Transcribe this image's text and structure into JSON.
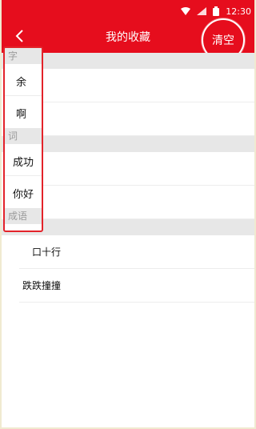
{
  "status_bar": {
    "time": "12:30",
    "icons": [
      "wifi-icon",
      "signal-icon",
      "battery-icon"
    ]
  },
  "header": {
    "title": "我的收藏",
    "back_icon": "chevron-left-icon",
    "clear_label": "清空"
  },
  "index_panel": {
    "sections": [
      {
        "header": "字",
        "items": [
          "余",
          "啊"
        ]
      },
      {
        "header": "词",
        "items": [
          "成功",
          "你好"
        ]
      },
      {
        "header": "成语",
        "items": []
      }
    ]
  },
  "list": {
    "sections": [
      {
        "items": [
          "",
          ""
        ]
      },
      {
        "items": [
          "",
          ""
        ]
      },
      {
        "items": [
          "口十行",
          "跌跌撞撞"
        ]
      }
    ]
  },
  "colors": {
    "brand_red": "#e60d1d",
    "section_bg": "#e7e7e7",
    "panel_border": "#e3232a"
  }
}
